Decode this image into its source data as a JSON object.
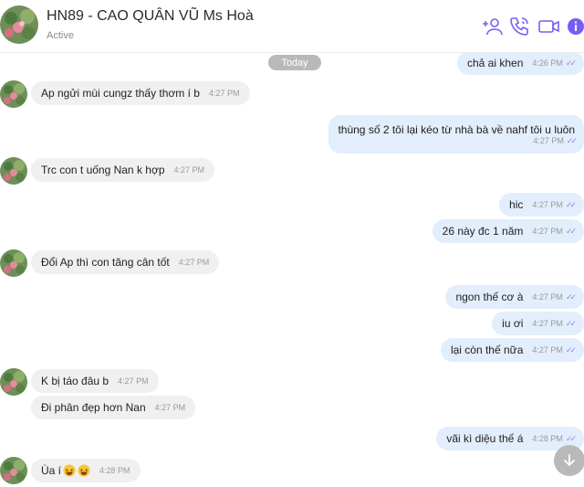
{
  "header": {
    "contact_name": "HN89 - CAO QUÂN VŨ Ms Hoà",
    "status": "Active"
  },
  "date_divider": "Today",
  "accent_color": "#7360f2",
  "messages": [
    {
      "dir": "out",
      "text": "chả ai khen",
      "time": "4:26 PM"
    },
    {
      "dir": "in",
      "text": "Ap ngửi mùi cungz thấy thơm í b",
      "time": "4:27 PM"
    },
    {
      "dir": "out",
      "text": "thùng số 2 tôi lại kéo từ nhà bà về nahf tôi u luôn",
      "time": "4:27 PM"
    },
    {
      "dir": "in",
      "text": "Trc con t uống Nan k hợp",
      "time": "4:27 PM"
    },
    {
      "dir": "out",
      "text": "hic",
      "time": "4:27 PM"
    },
    {
      "dir": "out",
      "text": "26 này đc 1 năm",
      "time": "4:27 PM"
    },
    {
      "dir": "in",
      "text": "Đổi Ap thì con tăng cân tốt",
      "time": "4:27 PM"
    },
    {
      "dir": "out",
      "text": "ngon thế cơ à",
      "time": "4:27 PM"
    },
    {
      "dir": "out",
      "text": "iu ơi",
      "time": "4:27 PM"
    },
    {
      "dir": "out",
      "text": "lại còn thế nữa",
      "time": "4:27 PM"
    },
    {
      "dir": "in",
      "text": "K bị táo đâu b",
      "time": "4:27 PM"
    },
    {
      "dir": "in",
      "text": "Đi phân đẹp hơn Nan",
      "time": "4:27 PM"
    },
    {
      "dir": "out",
      "text": "vãi kì diệu thế á",
      "time": "4:28 PM"
    },
    {
      "dir": "in",
      "text": "Ùa í",
      "time": "4:28 PM"
    }
  ]
}
